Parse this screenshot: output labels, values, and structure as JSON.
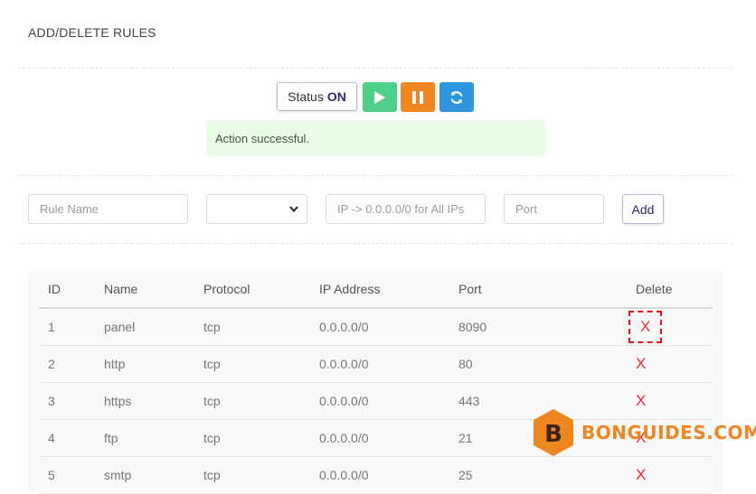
{
  "page": {
    "title": "ADD/DELETE RULES"
  },
  "toolbar": {
    "status_label": "Status",
    "status_value": "ON",
    "play_icon": "play-icon",
    "pause_icon": "pause-icon",
    "refresh_icon": "refresh-icon",
    "colors": {
      "play": "#4fd08a",
      "pause": "#f0861f",
      "refresh": "#2f95dd"
    }
  },
  "alert": {
    "message": "Action successful."
  },
  "form": {
    "rule_name_placeholder": "Rule Name",
    "protocol_selected": "",
    "ip_placeholder": "IP -> 0.0.0.0/0 for All IPs",
    "port_placeholder": "Port",
    "add_label": "Add"
  },
  "table": {
    "headers": [
      "ID",
      "Name",
      "Protocol",
      "IP Address",
      "Port",
      "Delete"
    ],
    "rows": [
      {
        "id": "1",
        "name": "panel",
        "protocol": "tcp",
        "ip": "0.0.0.0/0",
        "port": "8090",
        "delete": "X"
      },
      {
        "id": "2",
        "name": "http",
        "protocol": "tcp",
        "ip": "0.0.0.0/0",
        "port": "80",
        "delete": "X"
      },
      {
        "id": "3",
        "name": "https",
        "protocol": "tcp",
        "ip": "0.0.0.0/0",
        "port": "443",
        "delete": "X"
      },
      {
        "id": "4",
        "name": "ftp",
        "protocol": "tcp",
        "ip": "0.0.0.0/0",
        "port": "21",
        "delete": "X"
      },
      {
        "id": "5",
        "name": "smtp",
        "protocol": "tcp",
        "ip": "0.0.0.0/0",
        "port": "25",
        "delete": "X"
      }
    ]
  },
  "watermark": {
    "text": "BONGUIDES.COM",
    "letter": "B",
    "color": "#f0861f"
  }
}
